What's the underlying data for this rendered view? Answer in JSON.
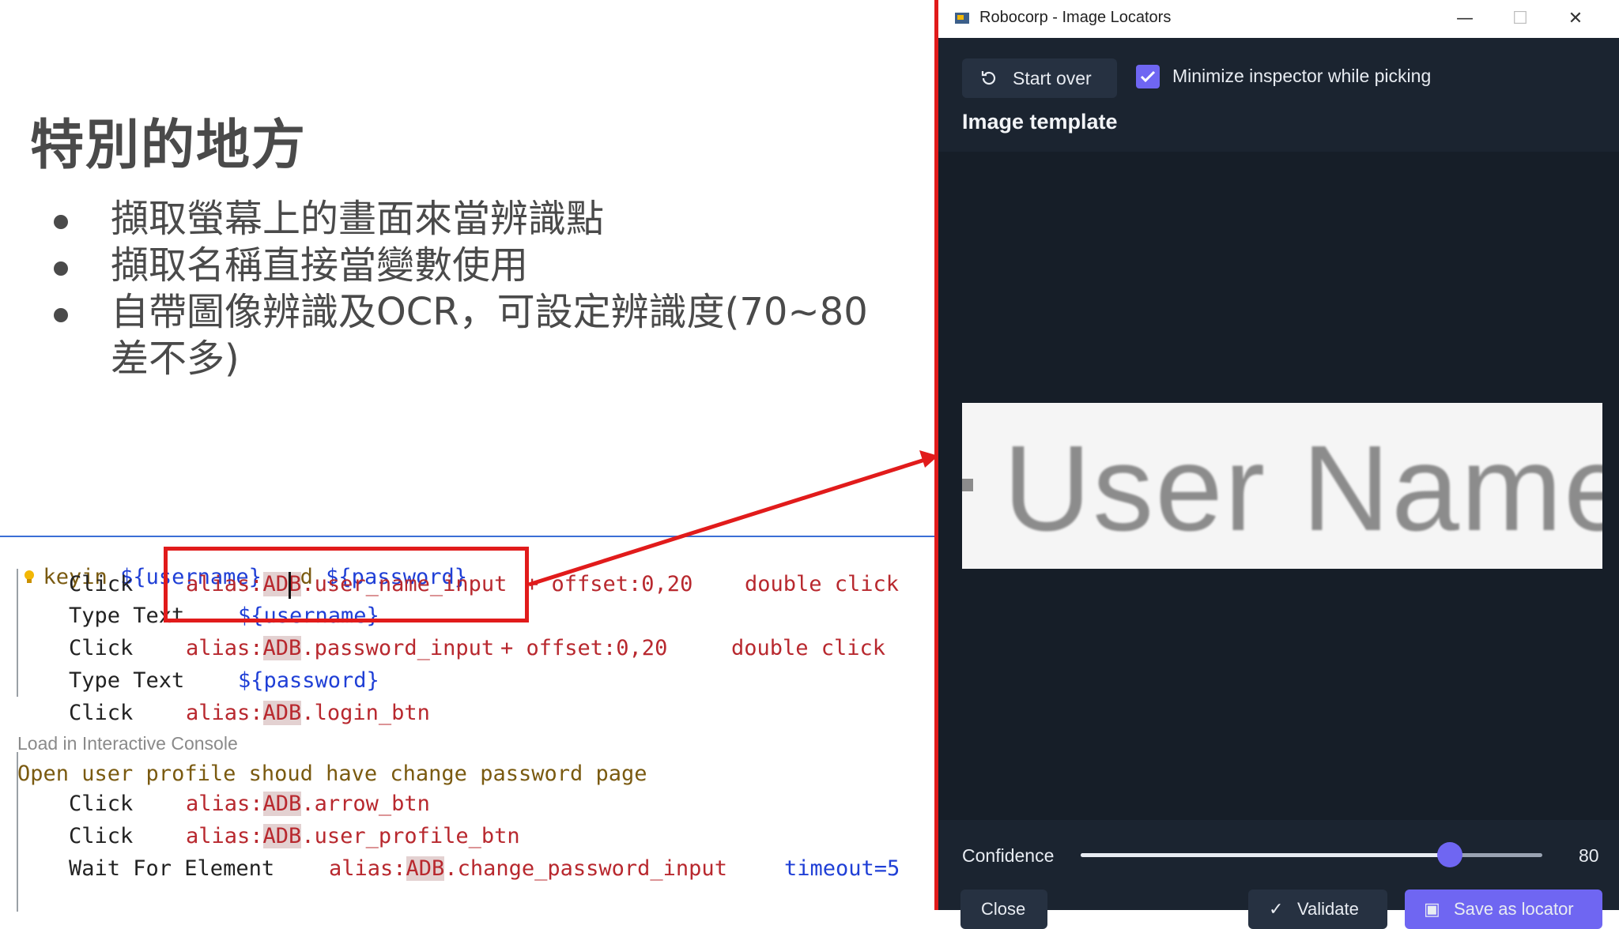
{
  "slide": {
    "title": "特別的地方",
    "bullets": [
      "擷取螢幕上的畫面來當辨識點",
      "擷取名稱直接當變數使用",
      "自帶圖像辨識及OCR，可設定辨識度(70~80差不多)"
    ]
  },
  "editor": {
    "lines": [
      {
        "a": "keyin ",
        "b": "${user",
        "c": "name}",
        "d": " and ",
        "e": "${password}"
      },
      {
        "kw": "Click",
        "arg1": "alias:",
        "hl": "ADB",
        "arg2": ".user_name_input",
        "extra": "+ offset:0,20",
        "extra2": "double click"
      },
      {
        "kw": "Type Text",
        "arg1": "${username}"
      },
      {
        "kw": "Click",
        "arg1": "alias:",
        "hl": "ADB",
        "arg2": ".password_input",
        "extra": "+ offset:0,20",
        "extra2": "double click"
      },
      {
        "kw": "Type Text",
        "arg1": "${password}"
      },
      {
        "kw": "Click",
        "arg1": "alias:",
        "hl": "ADB",
        "arg2": ".login_btn"
      },
      {
        "kw": "Open user profile shoud have change password page"
      },
      {
        "kw": "Click",
        "arg1": "alias:",
        "hl": "ADB",
        "arg2": ".arrow_btn"
      },
      {
        "kw": "Click",
        "arg1": "alias:",
        "hl": "ADB",
        "arg2": ".user_profile_btn"
      },
      {
        "kw": "Wait For Element",
        "arg1": "alias:",
        "hl": "ADB",
        "arg2": ".change_password_input",
        "extra": "timeout=5"
      }
    ],
    "console_link": "Load in Interactive Console"
  },
  "window": {
    "title": "Robocorp - Image Locators",
    "controls": {
      "minimize": "—",
      "maximize": "☐",
      "close": "✕"
    },
    "start_over": "Start over",
    "minimize_checkbox": {
      "label": "Minimize inspector while picking",
      "checked": true
    },
    "section_title": "Image template",
    "template_text": "User Name",
    "confidence_label": "Confidence",
    "confidence_value": "80",
    "confidence_fraction": 0.8,
    "buttons": {
      "close": "Close",
      "validate": "Validate",
      "save": "Save as locator"
    },
    "accent": "#6f66f2",
    "background": "#1b2430"
  },
  "callout_color": "#e11b1b"
}
